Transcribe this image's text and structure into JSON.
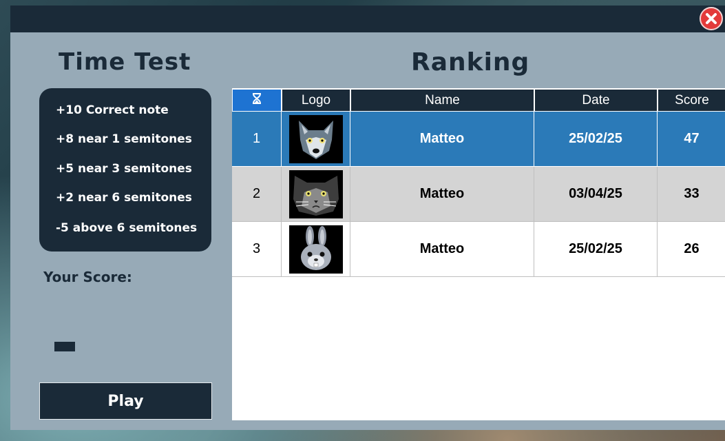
{
  "panel_left": {
    "title": "Time Test",
    "rules": [
      "+10 Correct note",
      "+8 near 1 semitones",
      "+5 near 3 semitones",
      "+2 near 6 semitones",
      "-5 above 6 semitones"
    ],
    "score_label": "Your Score:",
    "play_label": "Play"
  },
  "ranking": {
    "title": "Ranking",
    "columns": {
      "rank_icon": "hourglass-icon",
      "logo": "Logo",
      "name": "Name",
      "date": "Date",
      "score": "Score"
    },
    "rows": [
      {
        "rank": "1",
        "logo": "wolf-avatar",
        "name": "Matteo",
        "date": "25/02/25",
        "score": "47"
      },
      {
        "rank": "2",
        "logo": "cat-avatar",
        "name": "Matteo",
        "date": "03/04/25",
        "score": "33"
      },
      {
        "rank": "3",
        "logo": "rabbit-avatar",
        "name": "Matteo",
        "date": "25/02/25",
        "score": "26"
      }
    ]
  },
  "colors": {
    "dark": "#1a2a38",
    "panel": "#97aab7",
    "highlight": "#2b7ab8",
    "rank_header": "#1e73d2",
    "close": "#e33b3b"
  }
}
